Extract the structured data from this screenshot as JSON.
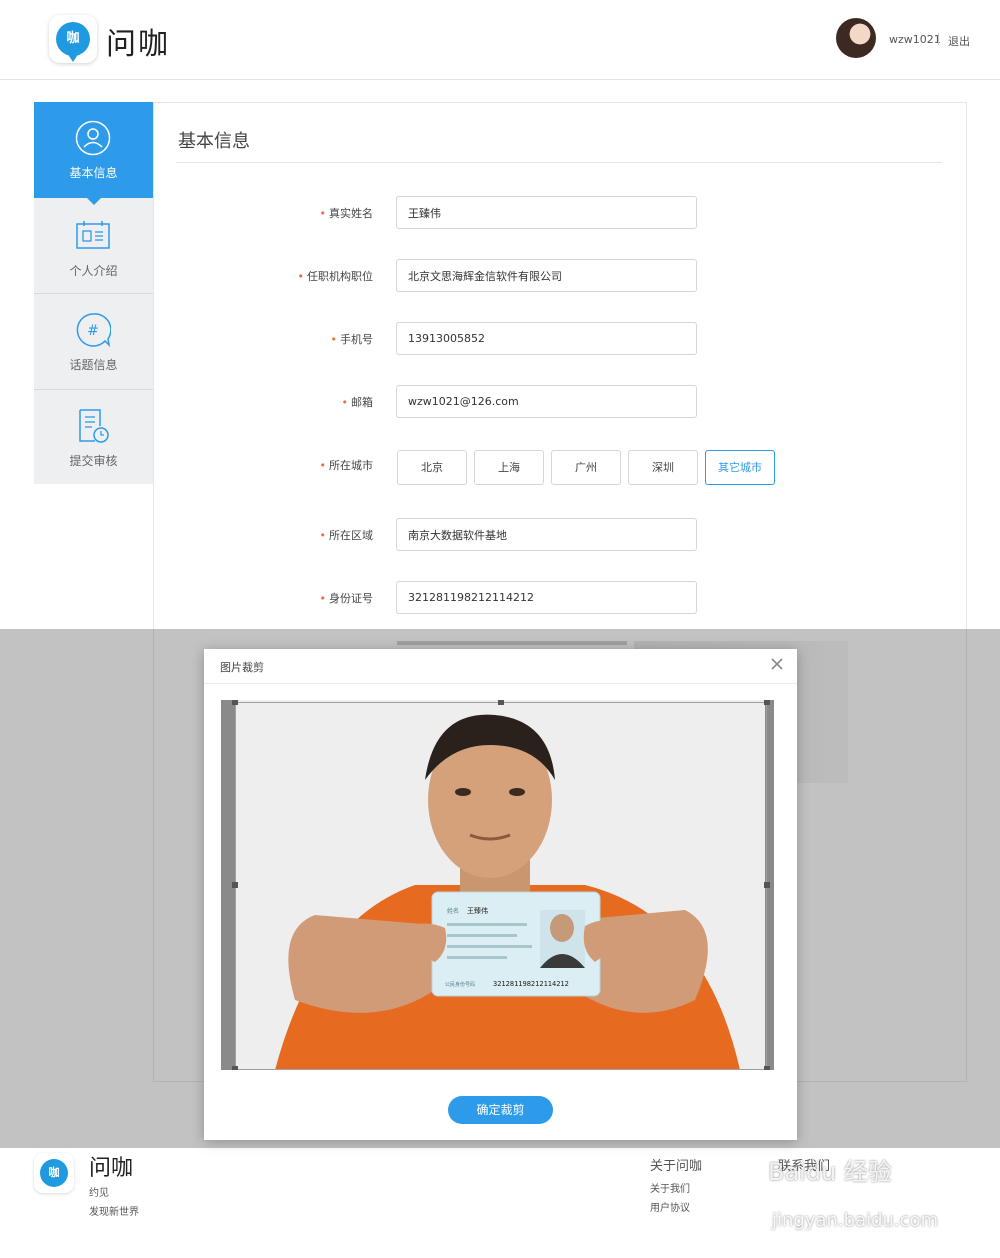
{
  "header": {
    "logo_glyph": "咖",
    "app_name": "问咖",
    "username": "wzw1021",
    "logout_label": "退出"
  },
  "sidebar": {
    "items": [
      {
        "label": "基本信息",
        "icon": "user-icon",
        "active": true
      },
      {
        "label": "个人介绍",
        "icon": "id-card-icon",
        "active": false
      },
      {
        "label": "话题信息",
        "icon": "hashtag-icon",
        "active": false
      },
      {
        "label": "提交审核",
        "icon": "document-clock-icon",
        "active": false
      }
    ]
  },
  "form": {
    "title": "基本信息",
    "fields": {
      "name": {
        "label": "真实姓名",
        "value": "王臻伟"
      },
      "org": {
        "label": "任职机构职位",
        "value": "北京文思海辉金信软件有限公司"
      },
      "phone": {
        "label": "手机号",
        "value": "13913005852"
      },
      "email": {
        "label": "邮箱",
        "value": "wzw1021@126.com"
      },
      "city": {
        "label": "所在城市",
        "options": [
          "北京",
          "上海",
          "广州",
          "深圳",
          "其它城市"
        ],
        "selected": "其它城市"
      },
      "area": {
        "label": "所在区域",
        "value": "南京大数据软件基地"
      },
      "idno": {
        "label": "身份证号",
        "value": "321281198212114212"
      }
    },
    "required_mark": "•"
  },
  "modal": {
    "title": "图片裁剪",
    "confirm_label": "确定裁剪",
    "photo": {
      "card_name": "王臻伟",
      "card_id": "321281198212114212"
    }
  },
  "footer": {
    "app_name": "问咖",
    "slogan_1": "约见",
    "slogan_2": "发现新世界",
    "col_about": {
      "title": "关于问咖",
      "links": [
        "关于我们",
        "用户协议"
      ]
    },
    "col_contact": {
      "title": "联系我们"
    }
  },
  "watermark": {
    "brand": "Baidu 经验",
    "url": "jingyan.baidu.com"
  },
  "colors": {
    "accent": "#2d9bea",
    "required": "#f06c3a",
    "overlay": "rgba(110,110,110,0.42)"
  }
}
